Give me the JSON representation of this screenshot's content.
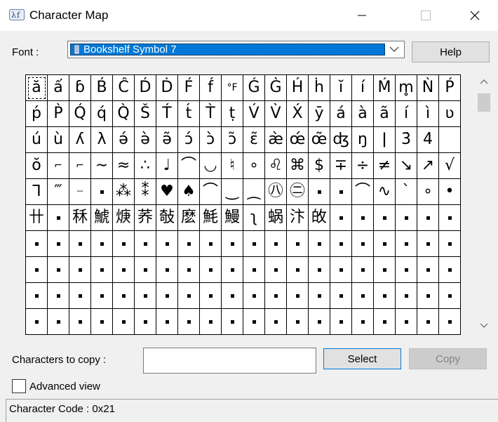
{
  "window": {
    "title": "Character Map"
  },
  "font": {
    "label": "Font :",
    "selected": "Bookshelf Symbol 7"
  },
  "buttons": {
    "help": "Help",
    "select": "Select",
    "copy": "Copy"
  },
  "copy": {
    "label": "Characters to copy :",
    "value": ""
  },
  "advanced": {
    "label": "Advanced view",
    "checked": false
  },
  "status": {
    "text": "Character Code : 0x21"
  },
  "selected_index": 0,
  "grid": {
    "columns": 20,
    "cells": [
      "ă",
      "ấ",
      "ɓ",
      "B́",
      "Ĉ",
      "D́",
      "Ḋ",
      "F́",
      "f́",
      "°F",
      "Ǵ",
      "G̀",
      "H́",
      "ḣ",
      "ĭ",
      "í",
      "Ḿ",
      "m̥",
      "Ǹ",
      "Ṕ",
      "ṕ",
      "P̀",
      "Q́",
      "q́",
      "Q̀",
      "Š",
      "T́",
      "t́",
      "T̀",
      "ṭ",
      "V́",
      "V̀",
      "X́",
      "ȳ",
      "á",
      "à",
      "ã",
      "í",
      "ì",
      "ʋ",
      "ú",
      "ù",
      "ʎ",
      "λ",
      "ə́",
      "ə̀",
      "ə̃",
      "ɔ́",
      "ɔ̀",
      "ɔ̃",
      "ɛ̃",
      "æ̀",
      "œ́",
      "œ̃",
      "ʤ",
      "ŋ",
      "ǀ",
      "3̇",
      "4̇",
      " ",
      "ŏ",
      "⌐",
      "⌐",
      "∼",
      "≈",
      "∴",
      "♩",
      "⌒",
      "◡",
      "♮",
      "∘",
      "♌",
      "⌘",
      "$",
      "∓",
      "÷",
      "≠",
      "↘",
      "↗",
      "√",
      "ᒣ",
      "‴",
      "┈",
      "▪",
      "⁂",
      "⁑",
      "♥",
      "♠",
      "⌒",
      "‿",
      "⁔",
      "㊇",
      "㊁",
      "▪",
      "▪",
      "⌒",
      "∿",
      "ˋ",
      "∘",
      "•",
      "卄",
      "▪",
      "秝",
      "鯱",
      "焿",
      "荞",
      "敧",
      "麽",
      "魹",
      "鰻",
      "ʅ",
      "蜗",
      "汴",
      "敀",
      "▪",
      "▪",
      "▪",
      "▪",
      "▪",
      "▪",
      "▪",
      "▪",
      "▪",
      "▪",
      "▪",
      "▪",
      "▪",
      "▪",
      "▪",
      "▪",
      "▪",
      "▪",
      "▪",
      "▪",
      "▪",
      "▪",
      "▪",
      "▪",
      "▪",
      "▪",
      "▪",
      "▪",
      "▪",
      "▪",
      "▪",
      "▪",
      "▪",
      "▪",
      "▪",
      "▪",
      "▪",
      "▪",
      "▪",
      "▪",
      "▪",
      "▪",
      "▪",
      "▪",
      "▪",
      "▪",
      "▪",
      "▪",
      "▪",
      "▪",
      "▪",
      "▪",
      "▪",
      "▪",
      "▪",
      "▪",
      "▪",
      "▪",
      "▪",
      "▪",
      "▪",
      "▪",
      "▪",
      "▪",
      "▪",
      "▪",
      "▪",
      "▪",
      "▪",
      "▪",
      "▪",
      "▪",
      "▪",
      "▪",
      "▪",
      "▪",
      "▪",
      "▪",
      "▪",
      "▪",
      "▪",
      "▪",
      "▪",
      "▪",
      "▪",
      "▪"
    ]
  }
}
